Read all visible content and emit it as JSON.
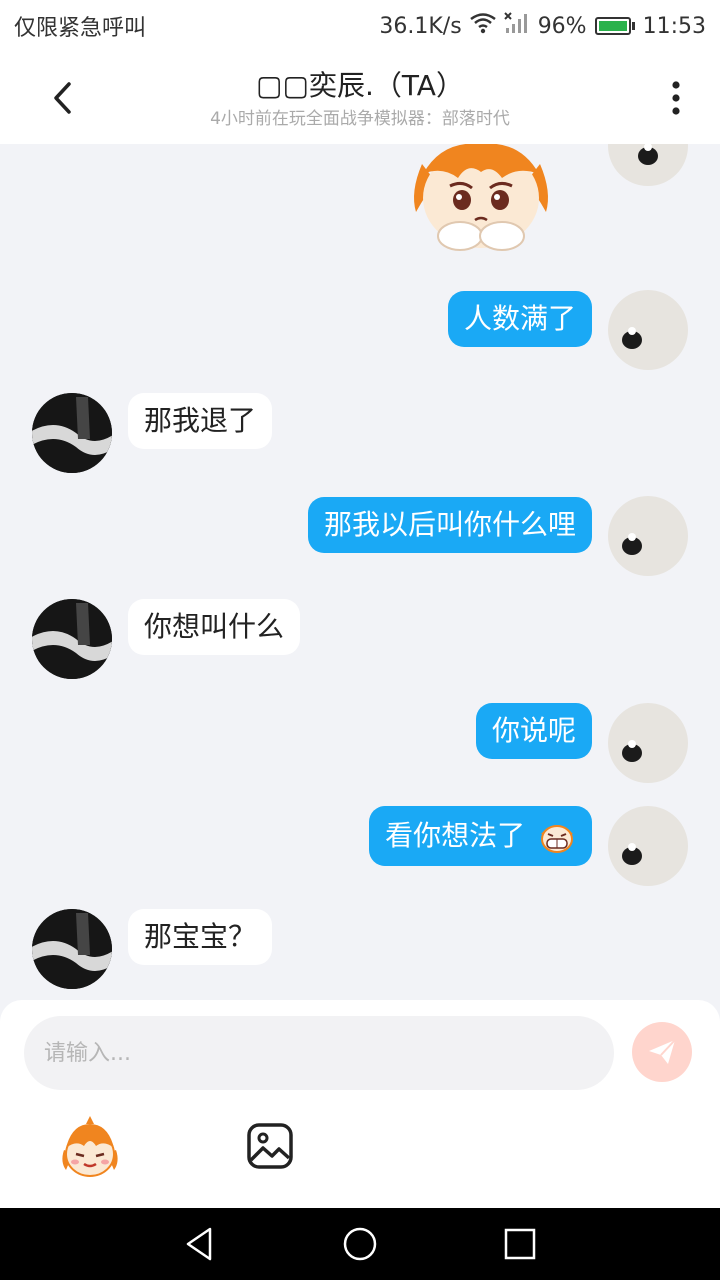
{
  "status_bar": {
    "left_text": "仅限紧急呼叫",
    "speed": "36.1K/s",
    "battery": "96%",
    "time": "11:53"
  },
  "header": {
    "title": "▢▢奕辰.（TA）",
    "subtitle": "4小时前在玩全面战争模拟器：部落时代"
  },
  "messages": [
    {
      "from": "self",
      "type": "sticker"
    },
    {
      "from": "self",
      "text": "人数满了"
    },
    {
      "from": "other",
      "text": "那我退了"
    },
    {
      "from": "self",
      "text": "那我以后叫你什么哩"
    },
    {
      "from": "other",
      "text": "你想叫什么"
    },
    {
      "from": "self",
      "text": "你说呢"
    },
    {
      "from": "self",
      "text": "看你想法了",
      "emoji": "grinning-cartoon-emoji"
    },
    {
      "from": "other",
      "text": "那宝宝？"
    }
  ],
  "input": {
    "placeholder": "请输入..."
  },
  "icons": {
    "back": "chevron-left-icon",
    "more": "vertical-dots-icon",
    "send": "paper-plane-icon",
    "emoji": "cartoon-face-icon",
    "image": "image-icon"
  },
  "colors": {
    "self_bubble": "#1aa9f5",
    "other_bubble": "#ffffff",
    "background": "#f2f3f7",
    "send_button": "#ffd5cd"
  }
}
